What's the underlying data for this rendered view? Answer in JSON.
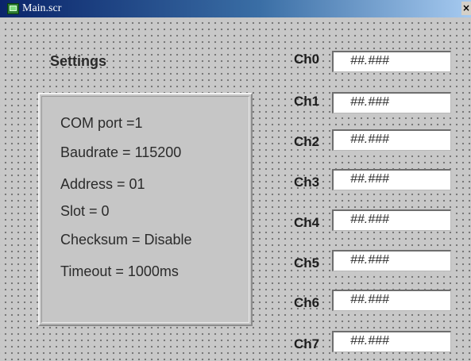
{
  "window": {
    "title": "Main.scr",
    "close_glyph": "×"
  },
  "settings": {
    "title": "Settings",
    "lines": [
      "COM port =1",
      "Baudrate = 115200",
      "Address = 01",
      "Slot = 0",
      "Checksum = Disable",
      "Timeout = 1000ms"
    ]
  },
  "channels": [
    {
      "label": "Ch0",
      "value": "##.###"
    },
    {
      "label": "Ch1",
      "value": "##.###"
    },
    {
      "label": "Ch2",
      "value": "##.###"
    },
    {
      "label": "Ch3",
      "value": "##.###"
    },
    {
      "label": "Ch4",
      "value": "##.###"
    },
    {
      "label": "Ch5",
      "value": "##.###"
    },
    {
      "label": "Ch6",
      "value": "##.###"
    },
    {
      "label": "Ch7",
      "value": "##.###"
    }
  ],
  "colors": {
    "titlebar_start": "#0a246a",
    "titlebar_end": "#a6caf0",
    "canvas": "#c8c8c8"
  }
}
